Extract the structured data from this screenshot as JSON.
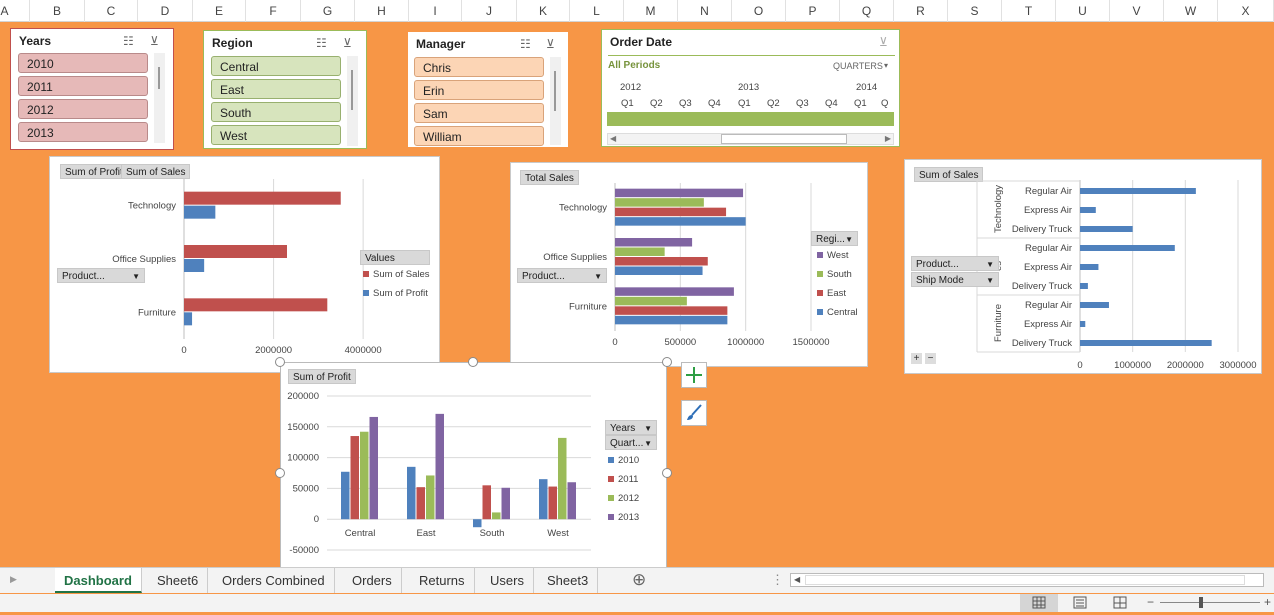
{
  "column_headers": [
    "A",
    "B",
    "C",
    "D",
    "E",
    "F",
    "G",
    "H",
    "I",
    "J",
    "K",
    "L",
    "M",
    "N",
    "O",
    "P",
    "Q",
    "R",
    "S",
    "T",
    "U",
    "V",
    "W",
    "X"
  ],
  "slicers": {
    "years": {
      "title": "Years",
      "items": [
        "2010",
        "2011",
        "2012",
        "2013"
      ],
      "color": "#E6B9B8"
    },
    "region": {
      "title": "Region",
      "items": [
        "Central",
        "East",
        "South",
        "West"
      ],
      "color": "#D7E4BD"
    },
    "manager": {
      "title": "Manager",
      "items": [
        "Chris",
        "Erin",
        "Sam",
        "William"
      ],
      "color": "#FCD5B5"
    }
  },
  "timeline": {
    "title": "Order Date",
    "all_periods": "All Periods",
    "level": "QUARTERS",
    "years": [
      "2012",
      "2013",
      "2014"
    ],
    "quarters": [
      "Q1",
      "Q2",
      "Q3",
      "Q4",
      "Q1",
      "Q2",
      "Q3",
      "Q4",
      "Q1",
      "Q"
    ]
  },
  "chart1": {
    "field_buttons": [
      "Sum of Profit",
      "Sum of Sales"
    ],
    "axis_field": "Product...",
    "legend_title": "Values",
    "chart_data": {
      "type": "bar",
      "categories": [
        "Technology",
        "Office Supplies",
        "Furniture"
      ],
      "series": [
        {
          "name": "Sum of Sales",
          "values": [
            3500000,
            2300000,
            3200000
          ],
          "color": "#C0504D"
        },
        {
          "name": "Sum of Profit",
          "values": [
            700000,
            450000,
            180000
          ],
          "color": "#4F81BD"
        }
      ],
      "xticks": [
        "0",
        "2000000",
        "4000000"
      ],
      "xlim": [
        0,
        4600000
      ]
    }
  },
  "chart2": {
    "field_buttons": [
      "Total Sales"
    ],
    "axis_field": "Product...",
    "legend_title": "Regi...",
    "chart_data": {
      "type": "bar",
      "categories": [
        "Technology",
        "Office Supplies",
        "Furniture"
      ],
      "series": [
        {
          "name": "West",
          "values": [
            980000,
            590000,
            910000
          ],
          "color": "#8064A2"
        },
        {
          "name": "South",
          "values": [
            680000,
            380000,
            550000
          ],
          "color": "#9BBB59"
        },
        {
          "name": "East",
          "values": [
            850000,
            710000,
            860000
          ],
          "color": "#C0504D"
        },
        {
          "name": "Central",
          "values": [
            1000000,
            670000,
            860000
          ],
          "color": "#4F81BD"
        }
      ],
      "xticks": [
        "0",
        "500000",
        "1000000",
        "1500000"
      ],
      "xlim": [
        0,
        1500000
      ]
    }
  },
  "chart3": {
    "field_buttons": [
      "Sum of Sales"
    ],
    "axis_fields": [
      "Product...",
      "Ship Mode"
    ],
    "group_labels": [
      "Technology",
      "es",
      "Furniture"
    ],
    "row_labels": [
      "Regular Air",
      "Express Air",
      "Delivery Truck",
      "Regular Air",
      "Express Air",
      "Delivery Truck",
      "Regular Air",
      "Express Air",
      "Delivery Truck"
    ],
    "chart_data": {
      "type": "bar",
      "categories": [
        "Technology / Regular Air",
        "Technology / Express Air",
        "Technology / Delivery Truck",
        "Office Supplies / Regular Air",
        "Office Supplies / Express Air",
        "Office Supplies / Delivery Truck",
        "Furniture / Regular Air",
        "Furniture / Express Air",
        "Furniture / Delivery Truck"
      ],
      "values": [
        2200000,
        300000,
        1000000,
        1800000,
        350000,
        150000,
        550000,
        100000,
        2500000
      ],
      "color": "#4F81BD",
      "xticks": [
        "0",
        "1000000",
        "2000000",
        "3000000"
      ],
      "xlim": [
        0,
        3200000
      ]
    },
    "expand": "+",
    "collapse": "−"
  },
  "chart4": {
    "field_buttons": [
      "Sum of Profit"
    ],
    "legend_fields": [
      "Years",
      "Quart..."
    ],
    "chart_data": {
      "type": "bar",
      "categories": [
        "Central",
        "East",
        "South",
        "West"
      ],
      "series": [
        {
          "name": "2010",
          "values": [
            77000,
            85000,
            -13000,
            65000
          ],
          "color": "#4F81BD"
        },
        {
          "name": "2011",
          "values": [
            135000,
            52000,
            55000,
            53000
          ],
          "color": "#C0504D"
        },
        {
          "name": "2012",
          "values": [
            142000,
            71000,
            11000,
            132000
          ],
          "color": "#9BBB59"
        },
        {
          "name": "2013",
          "values": [
            166000,
            171000,
            51000,
            60000
          ],
          "color": "#8064A2"
        }
      ],
      "yticks": [
        "200000",
        "150000",
        "100000",
        "50000",
        "0",
        "-50000"
      ],
      "ylim": [
        -50000,
        200000
      ]
    }
  },
  "tabs": [
    "Dashboard",
    "Sheet6",
    "Orders Combined",
    "Orders",
    "Returns",
    "Users",
    "Sheet3"
  ],
  "active_tab": "Dashboard",
  "add_sheet": "⊕",
  "tab_options": "⋮"
}
